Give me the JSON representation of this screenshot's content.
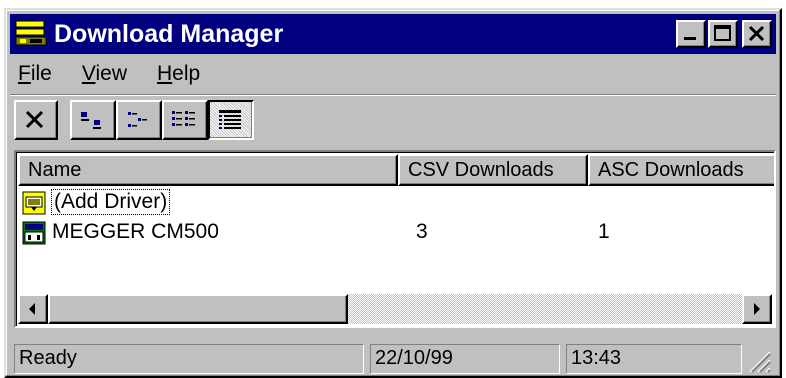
{
  "window": {
    "title": "Download Manager"
  },
  "menu": {
    "items": [
      {
        "label_rest": "ile",
        "mnemonic": "F"
      },
      {
        "label_rest": "iew",
        "mnemonic": "V"
      },
      {
        "label_rest": "elp",
        "mnemonic": "H"
      }
    ]
  },
  "toolbar": {
    "buttons": [
      "delete-icon",
      "large-icons-view-icon",
      "small-icons-view-icon",
      "list-view-icon",
      "details-view-icon"
    ],
    "active_view": "details"
  },
  "list": {
    "columns": [
      "Name",
      "CSV Downloads",
      "ASC Downloads"
    ],
    "rows": [
      {
        "name": "(Add Driver)",
        "csv": "",
        "asc": "",
        "icon": "add-driver-icon",
        "focused": true
      },
      {
        "name": "MEGGER CM500",
        "csv": "3",
        "asc": "1",
        "icon": "device-icon",
        "focused": false
      }
    ]
  },
  "statusbar": {
    "status": "Ready",
    "date": "22/10/99",
    "time": "13:43"
  },
  "colors": {
    "titlebar": "#000080",
    "face": "#c0c0c0"
  }
}
